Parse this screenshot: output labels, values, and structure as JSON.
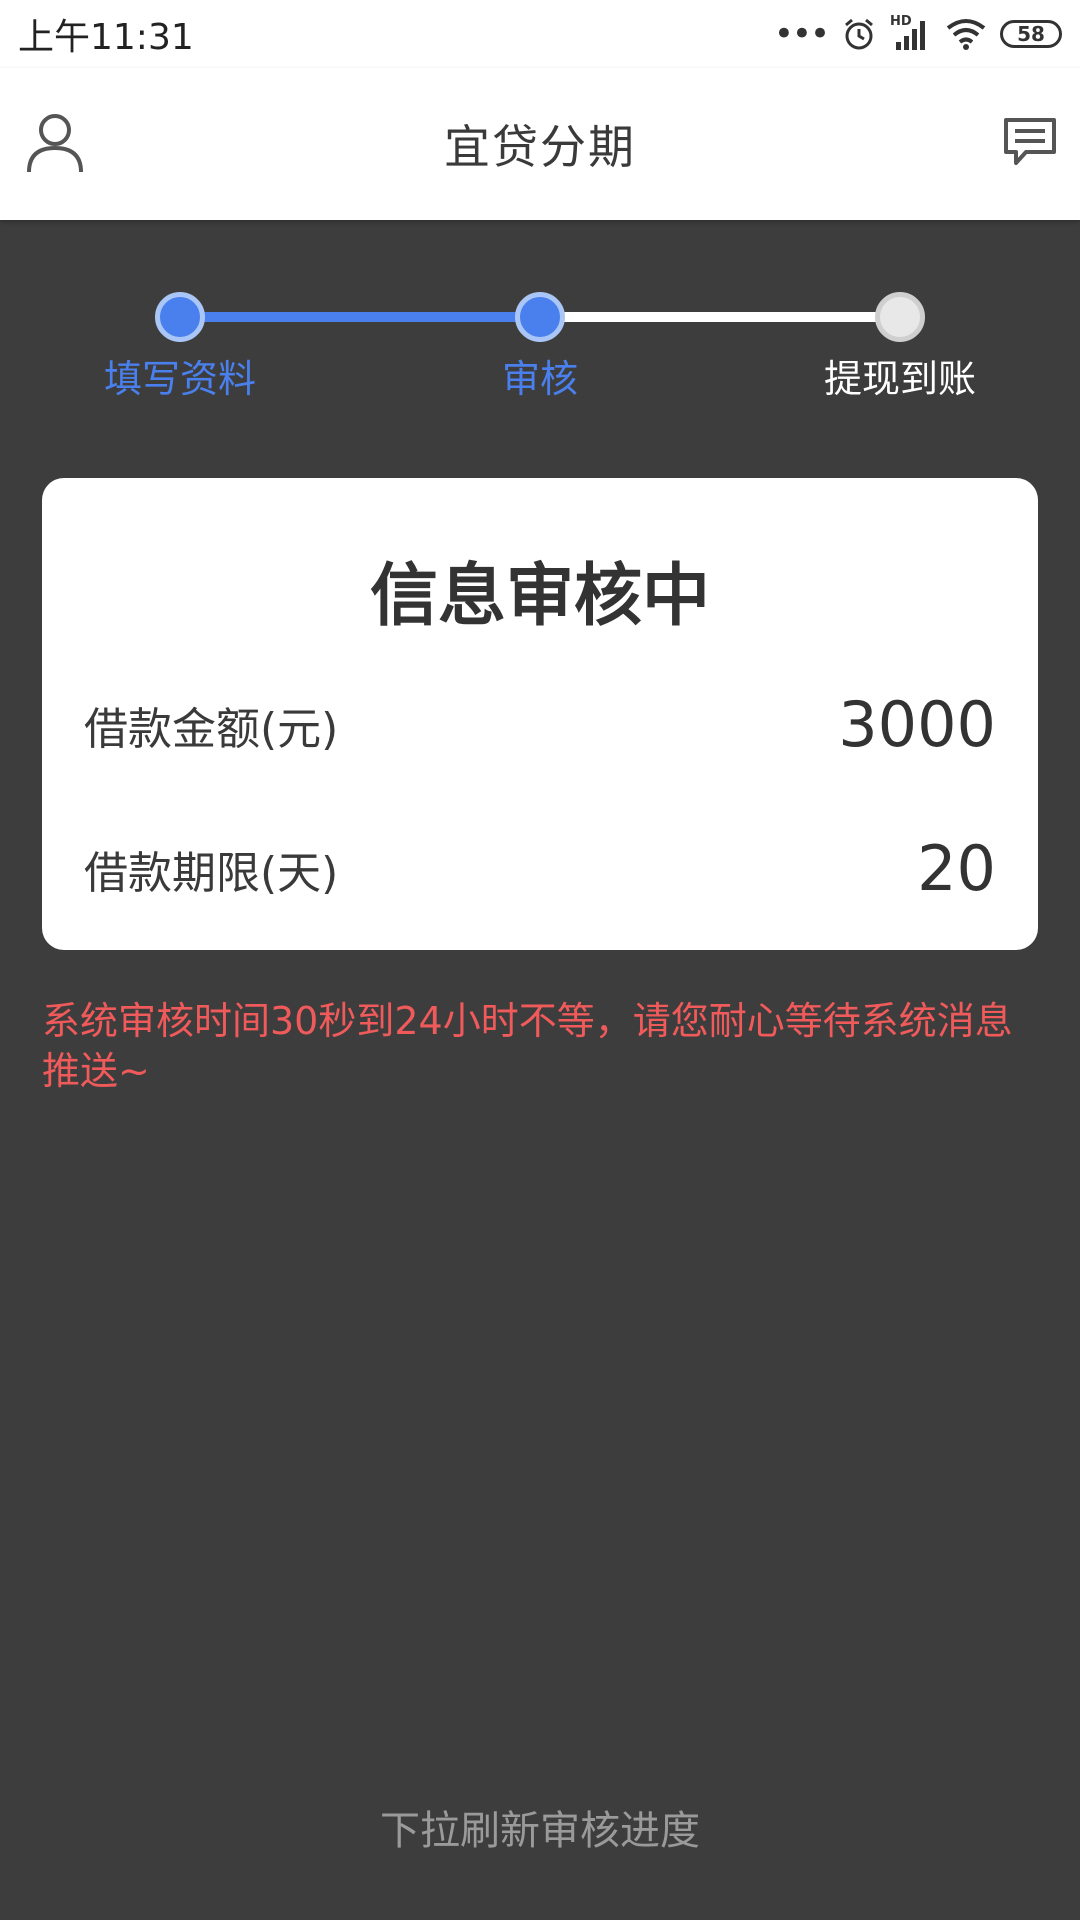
{
  "status_bar": {
    "time": "上午11:31",
    "hd_label": "HD",
    "battery": "58"
  },
  "header": {
    "title": "宜贷分期",
    "left_icon": "person-icon",
    "right_icon": "message-icon"
  },
  "stepper": {
    "steps": [
      {
        "label": "填写资料",
        "state": "done"
      },
      {
        "label": "审核",
        "state": "current"
      },
      {
        "label": "提现到账",
        "state": "pending"
      }
    ],
    "active_color": "#4a80ee"
  },
  "card": {
    "title": "信息审核中",
    "rows": [
      {
        "label": "借款金额(元)",
        "value": "3000"
      },
      {
        "label": "借款期限(天)",
        "value": "20"
      }
    ]
  },
  "notice": "系统审核时间30秒到24小时不等，请您耐心等待系统消息推送~",
  "pull_hint": "下拉刷新审核进度"
}
